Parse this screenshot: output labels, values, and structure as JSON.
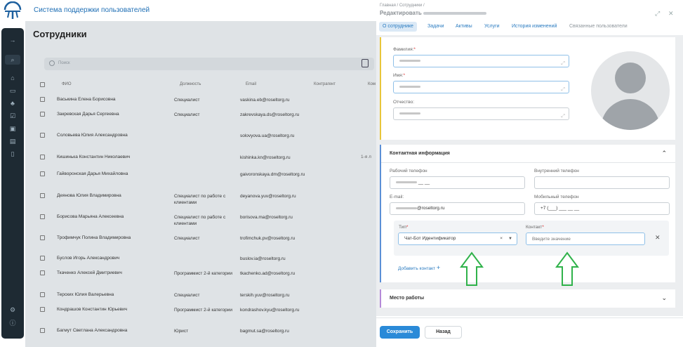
{
  "app": {
    "title": "Система поддержки пользователей"
  },
  "page": {
    "title": "Сотрудники"
  },
  "search": {
    "placeholder": "Поиск"
  },
  "columns": [
    "ФИО",
    "Должность",
    "Email",
    "Контрагент",
    "Ком"
  ],
  "rows": [
    {
      "name": "Васькина Елена Борисовна",
      "position": "Специалист",
      "email": "vaskina.eb@roseltorg.ru"
    },
    {
      "name": "Закревская Дарья Сергеевна",
      "position": "Специалист",
      "email": "zakrevskaya.ds@roseltorg.ru"
    },
    {
      "name": "Соловьева Юлия Александровна",
      "position": "",
      "email": "solovyova.ua@roseltorg.ru"
    },
    {
      "name": "Кишинька Константин Николаевич",
      "position": "",
      "email": "kishinka.kn@roseltorg.ru",
      "extra": "1-я л"
    },
    {
      "name": "Гайворонская Дарья Михайловна",
      "position": "",
      "email": "gaivoronskaya.dm@roseltorg.ru"
    },
    {
      "name": "Деянова Юлия Владимировна",
      "position": "Специалист по работе с клиентами",
      "email": "deyanova.yuv@roseltorg.ru"
    },
    {
      "name": "Борисова Марьяна Алексеевна",
      "position": "Специалист по работе с клиентами",
      "email": "borisova.ma@roseltorg.ru"
    },
    {
      "name": "Трофимчук Полина Владимировна",
      "position": "Специалист",
      "email": "trofimchuk.pv@roseltorg.ru"
    },
    {
      "name": "Буслов Игорь Александрович",
      "position": "",
      "email": "buslov.ia@roseltorg.ru"
    },
    {
      "name": "Ткаченко Алексей Дмитриевич",
      "position": "Программист 2-й категории",
      "email": "tkachenko.ad@roseltorg.ru"
    },
    {
      "name": "Терских Юлия Валерьевна",
      "position": "Специалист",
      "email": "terskih.yuv@roseltorg.ru"
    },
    {
      "name": "Кондрашов Константин Юрьевич",
      "position": "Программист 2-й категории",
      "email": "kondrashov.kyu@roseltorg.ru"
    },
    {
      "name": "Багмут Светлана Александровна",
      "position": "Юрист",
      "email": "bagmut.sa@roseltorg.ru"
    }
  ],
  "panel": {
    "breadcrumb": "Главная / Сотрудники /",
    "title": "Редактировать",
    "tabs": [
      "О сотруднике",
      "Задачи",
      "Активы",
      "Услуги",
      "История изменений",
      "Связанные пользователи"
    ],
    "fields": {
      "lastname_label": "Фамилия:",
      "firstname_label": "Имя:",
      "middlename_label": "Отчество:",
      "required_mark": "*"
    },
    "contact_section": "Контактная информация",
    "work_phone_label": "Рабочий телефон",
    "work_phone_suffix": "__ __",
    "internal_phone_label": "Внутренний телефон",
    "email_label": "E-mail:",
    "email_value": "@roseltorg.ru",
    "mobile_label": "Мобильный телефон",
    "mobile_value": "+7 (___) ___ __ __",
    "type_label": "Тип",
    "type_value": "Чат-Бот Идентификатор",
    "contact_label": "Контакт",
    "contact_placeholder": "Введите значение",
    "add_contact": "Добавить контакт",
    "workplace_section": "Место работы",
    "save": "Сохранить",
    "back": "Назад"
  },
  "colors": {
    "accent": "#2a8ad8",
    "sidebar": "#1e2a33",
    "arrow": "#2fb24a"
  }
}
